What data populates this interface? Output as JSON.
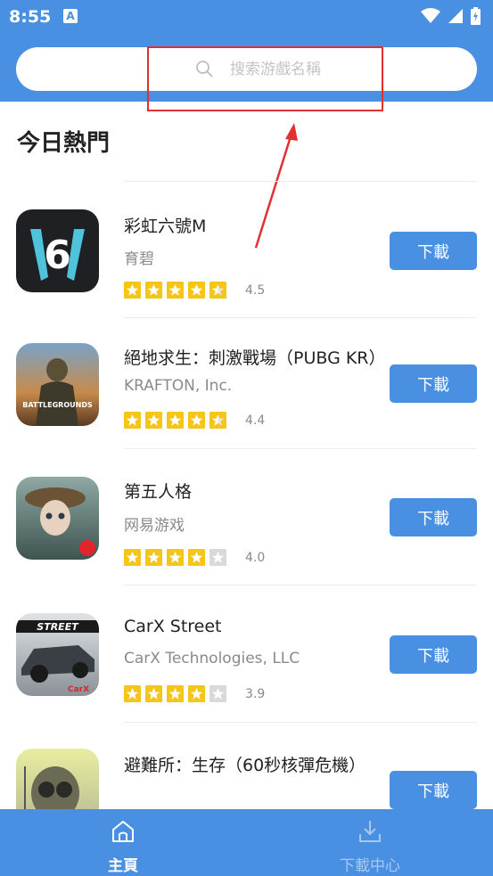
{
  "status_bar": {
    "time": "8:55",
    "badge": "A"
  },
  "search": {
    "placeholder": "搜索游戲名稱"
  },
  "section": {
    "title": "今日熱門"
  },
  "colors": {
    "primary": "#4a90e2",
    "star": "#f5c518",
    "annotation": "#e03131"
  },
  "apps": [
    {
      "name": "彩虹六號M",
      "developer": "育碧",
      "rating": "4.5",
      "stars": 4.5,
      "button": "下載",
      "icon": "rainbow-six-logo-icon"
    },
    {
      "name": "絕地求生：刺激戰場（PUBG KR）",
      "developer": "KRAFTON, Inc.",
      "rating": "4.4",
      "stars": 4.5,
      "button": "下載",
      "icon": "pubg-battlegrounds-icon"
    },
    {
      "name": "第五人格",
      "developer": "网易游戏",
      "rating": "4.0",
      "stars": 4,
      "button": "下載",
      "icon": "identity-v-icon"
    },
    {
      "name": "CarX Street",
      "developer": "CarX Technologies, LLC",
      "rating": "3.9",
      "stars": 4,
      "button": "下載",
      "icon": "carx-street-icon"
    },
    {
      "name": "避難所：生存（60秒核彈危機）",
      "developer": "",
      "rating": "",
      "stars": 0,
      "button": "下載",
      "icon": "shelter-survival-icon"
    }
  ],
  "bottom_nav": [
    {
      "label": "主頁",
      "icon": "home-icon",
      "active": true
    },
    {
      "label": "下載中心",
      "icon": "download-icon",
      "active": false
    }
  ]
}
